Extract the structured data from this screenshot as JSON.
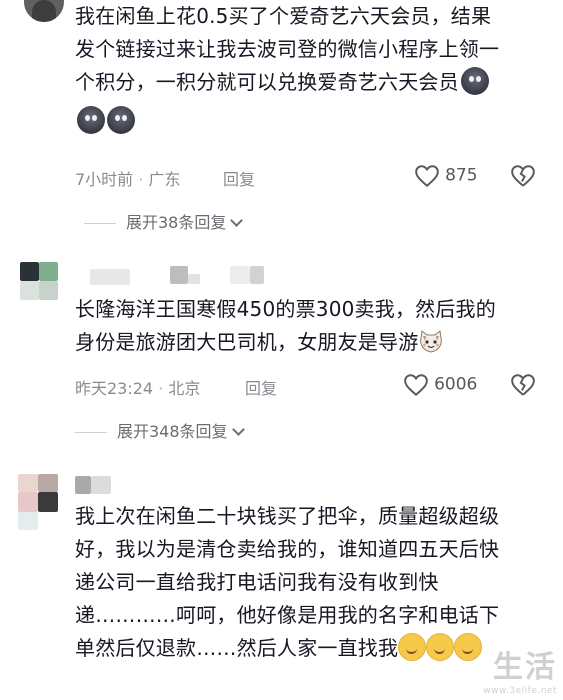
{
  "comments": [
    {
      "text_lines": [
        "我在闲鱼上花0.5买了个爱奇艺六天会员，结果",
        "发个链接过来让我去波司登的微信小程序上领一",
        "个积分，一积分就可以兑换爱奇艺六天会员"
      ],
      "time": "7小时前",
      "location": "广东",
      "reply_label": "回复",
      "likes": "875",
      "expand_label": "展开38条回复"
    },
    {
      "text_lines": [
        "长隆海洋王国寒假450的票300卖我，然后我的",
        "身份是旅游团大巴司机，女朋友是导游"
      ],
      "time": "昨天23:24",
      "location": "北京",
      "reply_label": "回复",
      "likes": "6006",
      "expand_label": "展开348条回复"
    },
    {
      "text_lines": [
        "我上次在闲鱼二十块钱买了把伞，质量超级超级",
        "好，我以为是清仓卖给我的，谁知道四五天后快",
        "递公司一直给我打电话问我有没有收到快",
        "递…………呵呵，他好像是用我的名字和电话下",
        "单然后仅退款……然后人家一直找我"
      ]
    }
  ],
  "icons": {
    "like": "heart-outline-icon",
    "dislike": "broken-heart-icon",
    "expand": "chevron-down-icon"
  },
  "watermark": {
    "text": "生活",
    "url": "www.3elife.net"
  }
}
